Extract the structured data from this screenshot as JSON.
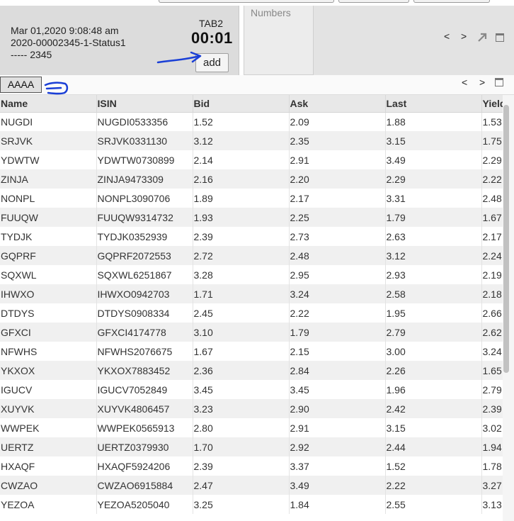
{
  "header": {
    "datetime": "Mar 01,2020 9:08:48 am",
    "reference": "2020-00002345-1-Status1",
    "code": "----- 2345",
    "tab_label": "TAB2",
    "timer": "00:01",
    "add_label": "add"
  },
  "numbers_panel": {
    "label": "Numbers",
    "prev": "<",
    "next": ">"
  },
  "tab_row": {
    "active_tab": "AAAA",
    "prev": "<",
    "next": ">"
  },
  "table": {
    "columns": [
      "Name",
      "ISIN",
      "Bid",
      "Ask",
      "Last",
      "Yield"
    ],
    "rows": [
      [
        "NUGDI",
        "NUGDI0533356",
        "1.52",
        "2.09",
        "1.88",
        "1.53"
      ],
      [
        "SRJVK",
        "SRJVK0331130",
        "3.12",
        "2.35",
        "3.15",
        "1.75"
      ],
      [
        "YDWTW",
        "YDWTW0730899",
        "2.14",
        "2.91",
        "3.49",
        "2.29"
      ],
      [
        "ZINJA",
        "ZINJA9473309",
        "2.16",
        "2.20",
        "2.29",
        "2.22"
      ],
      [
        "NONPL",
        "NONPL3090706",
        "1.89",
        "2.17",
        "3.31",
        "2.48"
      ],
      [
        "FUUQW",
        "FUUQW9314732",
        "1.93",
        "2.25",
        "1.79",
        "1.67"
      ],
      [
        "TYDJK",
        "TYDJK0352939",
        "2.39",
        "2.73",
        "2.63",
        "2.17"
      ],
      [
        "GQPRF",
        "GQPRF2072553",
        "2.72",
        "2.48",
        "3.12",
        "2.24"
      ],
      [
        "SQXWL",
        "SQXWL6251867",
        "3.28",
        "2.95",
        "2.93",
        "2.19"
      ],
      [
        "IHWXO",
        "IHWXO0942703",
        "1.71",
        "3.24",
        "2.58",
        "2.18"
      ],
      [
        "DTDYS",
        "DTDYS0908334",
        "2.45",
        "2.22",
        "1.95",
        "2.66"
      ],
      [
        "GFXCI",
        "GFXCI4174778",
        "3.10",
        "1.79",
        "2.79",
        "2.62"
      ],
      [
        "NFWHS",
        "NFWHS2076675",
        "1.67",
        "2.15",
        "3.00",
        "3.24"
      ],
      [
        "YKXOX",
        "YKXOX7883452",
        "2.36",
        "2.84",
        "2.26",
        "1.65"
      ],
      [
        "IGUCV",
        "IGUCV7052849",
        "3.45",
        "3.45",
        "1.96",
        "2.79"
      ],
      [
        "XUYVK",
        "XUYVK4806457",
        "3.23",
        "2.90",
        "2.42",
        "2.39"
      ],
      [
        "WWPEK",
        "WWPEK0565913",
        "2.80",
        "2.91",
        "3.15",
        "3.02"
      ],
      [
        "UERTZ",
        "UERTZ0379930",
        "1.70",
        "2.92",
        "2.44",
        "1.94"
      ],
      [
        "HXAQF",
        "HXAQF5924206",
        "2.39",
        "3.37",
        "1.52",
        "1.78"
      ],
      [
        "CWZAO",
        "CWZAO6915884",
        "2.47",
        "3.49",
        "2.22",
        "3.27"
      ],
      [
        "YEZOA",
        "YEZOA5205040",
        "3.25",
        "1.84",
        "2.55",
        "3.13"
      ]
    ]
  },
  "colors": {
    "header_bg": "#dcdcdc",
    "row_alt": "#f0f0f0",
    "annotation": "#1a3fd6"
  },
  "icons": [
    "popout-icon",
    "window-icon"
  ]
}
